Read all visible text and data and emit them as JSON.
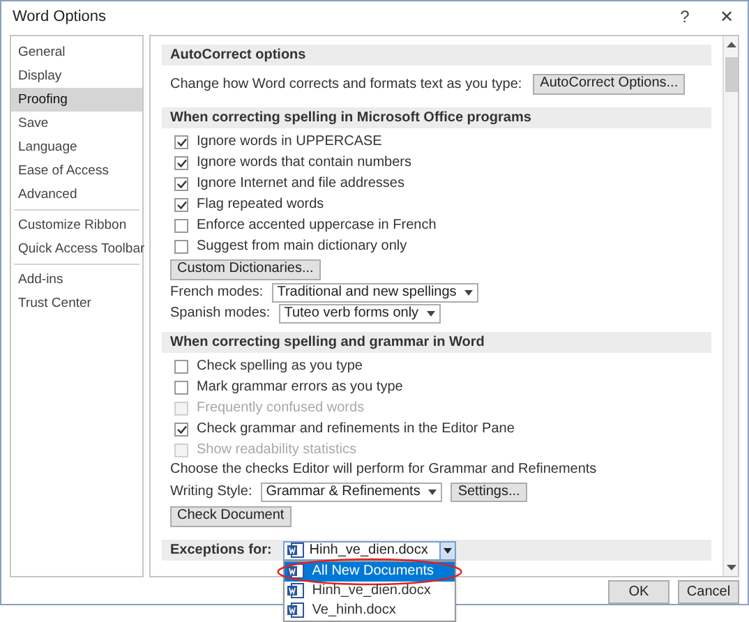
{
  "window": {
    "title": "Word Options",
    "help": "?",
    "close": "✕"
  },
  "sidebar": {
    "groups": [
      [
        {
          "label": "General",
          "selected": false
        },
        {
          "label": "Display",
          "selected": false
        },
        {
          "label": "Proofing",
          "selected": true
        },
        {
          "label": "Save",
          "selected": false
        },
        {
          "label": "Language",
          "selected": false
        },
        {
          "label": "Ease of Access",
          "selected": false
        },
        {
          "label": "Advanced",
          "selected": false
        }
      ],
      [
        {
          "label": "Customize Ribbon",
          "selected": false
        },
        {
          "label": "Quick Access Toolbar",
          "selected": false
        }
      ],
      [
        {
          "label": "Add-ins",
          "selected": false
        },
        {
          "label": "Trust Center",
          "selected": false
        }
      ]
    ]
  },
  "sections": [
    {
      "title": "AutoCorrect options",
      "items": [
        {
          "kind": "text_button",
          "text": "Change how Word corrects and formats text as you type:",
          "button": "AutoCorrect Options..."
        }
      ]
    },
    {
      "title": "When correcting spelling in Microsoft Office programs",
      "items": [
        {
          "kind": "checkbox",
          "label": "Ignore words in UPPERCASE",
          "checked": true,
          "disabled": false
        },
        {
          "kind": "checkbox",
          "label": "Ignore words that contain numbers",
          "checked": true,
          "disabled": false
        },
        {
          "kind": "checkbox",
          "label": "Ignore Internet and file addresses",
          "checked": true,
          "disabled": false
        },
        {
          "kind": "checkbox",
          "label": "Flag repeated words",
          "checked": true,
          "disabled": false
        },
        {
          "kind": "checkbox",
          "label": "Enforce accented uppercase in French",
          "checked": false,
          "disabled": false
        },
        {
          "kind": "checkbox",
          "label": "Suggest from main dictionary only",
          "checked": false,
          "disabled": false
        },
        {
          "kind": "button",
          "button": "Custom Dictionaries..."
        },
        {
          "kind": "select",
          "label": "French modes:",
          "value": "Traditional and new spellings"
        },
        {
          "kind": "select",
          "label": "Spanish modes:",
          "value": "Tuteo verb forms only"
        }
      ]
    },
    {
      "title": "When correcting spelling and grammar in Word",
      "items": [
        {
          "kind": "checkbox",
          "label": "Check spelling as you type",
          "checked": false,
          "disabled": false
        },
        {
          "kind": "checkbox",
          "label": "Mark grammar errors as you type",
          "checked": false,
          "disabled": false
        },
        {
          "kind": "checkbox",
          "label": "Frequently confused words",
          "checked": false,
          "disabled": true
        },
        {
          "kind": "checkbox",
          "label": "Check grammar and refinements in the Editor Pane",
          "checked": true,
          "disabled": false
        },
        {
          "kind": "checkbox",
          "label": "Show readability statistics",
          "checked": false,
          "disabled": true
        },
        {
          "kind": "text",
          "text": "Choose the checks Editor will perform for Grammar and Refinements"
        },
        {
          "kind": "select_button",
          "label": "Writing Style:",
          "value": "Grammar & Refinements",
          "button": "Settings..."
        },
        {
          "kind": "button",
          "button": "Check Document"
        }
      ]
    }
  ],
  "exceptions": {
    "label": "Exceptions for:",
    "value": "Hinh_ve_dien.docx",
    "options": [
      {
        "label": "All New Documents",
        "highlighted": true
      },
      {
        "label": "Hinh_ve_dien.docx",
        "highlighted": false
      },
      {
        "label": "Ve_hinh.docx",
        "highlighted": false
      }
    ]
  },
  "buttons": [
    "OK",
    "Cancel"
  ]
}
